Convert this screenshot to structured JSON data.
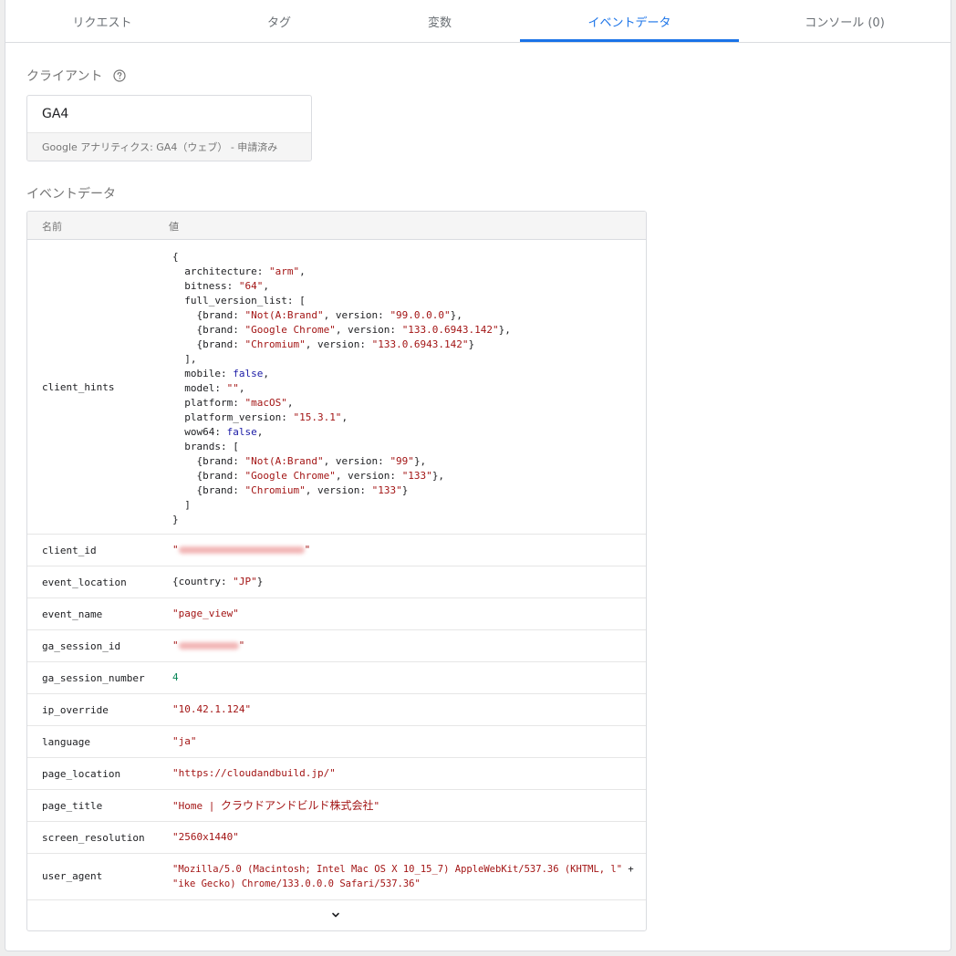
{
  "tabs": [
    {
      "label": "リクエスト"
    },
    {
      "label": "タグ"
    },
    {
      "label": "変数"
    },
    {
      "label": "イベントデータ",
      "active": true
    },
    {
      "label": "コンソール (0)"
    }
  ],
  "accent_color": "#1a73e8",
  "client_section": {
    "label": "クライアント",
    "help_icon": "help-circle-icon",
    "client_name": "GA4",
    "client_description": "Google アナリティクス: GA4（ウェブ） - 申請済み"
  },
  "event_section": {
    "label": "イベントデータ",
    "columns": {
      "name": "名前",
      "value": "値"
    },
    "client_hints": {
      "key": "client_hints",
      "lines": [
        "{",
        "  architecture: \"arm\",",
        "  bitness: \"64\",",
        "  full_version_list: [",
        "    {brand: \"Not(A:Brand\", version: \"99.0.0.0\"},",
        "    {brand: \"Google Chrome\", version: \"133.0.6943.142\"},",
        "    {brand: \"Chromium\", version: \"133.0.6943.142\"}",
        "  ],",
        "  mobile: false,",
        "  model: \"\",",
        "  platform: \"macOS\",",
        "  platform_version: \"15.3.1\",",
        "  wow64: false,",
        "  brands: [",
        "    {brand: \"Not(A:Brand\", version: \"99\"},",
        "    {brand: \"Google Chrome\", version: \"133\"},",
        "    {brand: \"Chromium\", version: \"133\"}",
        "  ]",
        "}"
      ]
    },
    "rows": [
      {
        "key": "client_id"
      },
      {
        "key": "event_location",
        "value": "{country: \"JP\"}"
      },
      {
        "key": "event_name",
        "value": "\"page_view\""
      },
      {
        "key": "ga_session_id"
      },
      {
        "key": "ga_session_number",
        "value": "4"
      },
      {
        "key": "ip_override",
        "value": "\"10.42.1.124\""
      },
      {
        "key": "language",
        "value": "\"ja\""
      },
      {
        "key": "page_location",
        "value": "\"https://cloudandbuild.jp/\""
      },
      {
        "key": "page_title",
        "value_prefix": "\"Home | ",
        "value_jp": "クラウドアンドビルド株式会社",
        "value_suffix": "\""
      },
      {
        "key": "screen_resolution",
        "value": "\"2560x1440\""
      },
      {
        "key": "user_agent",
        "value_line1": "\"Mozilla/5.0 (Macintosh; Intel Mac OS X 10_15_7) AppleWebKit/537.36 (KHTML, l\" +",
        "value_line2": "\"ike Gecko) Chrome/133.0.0.0 Safari/537.36\""
      }
    ],
    "expand_icon": "chevron-down-icon"
  }
}
